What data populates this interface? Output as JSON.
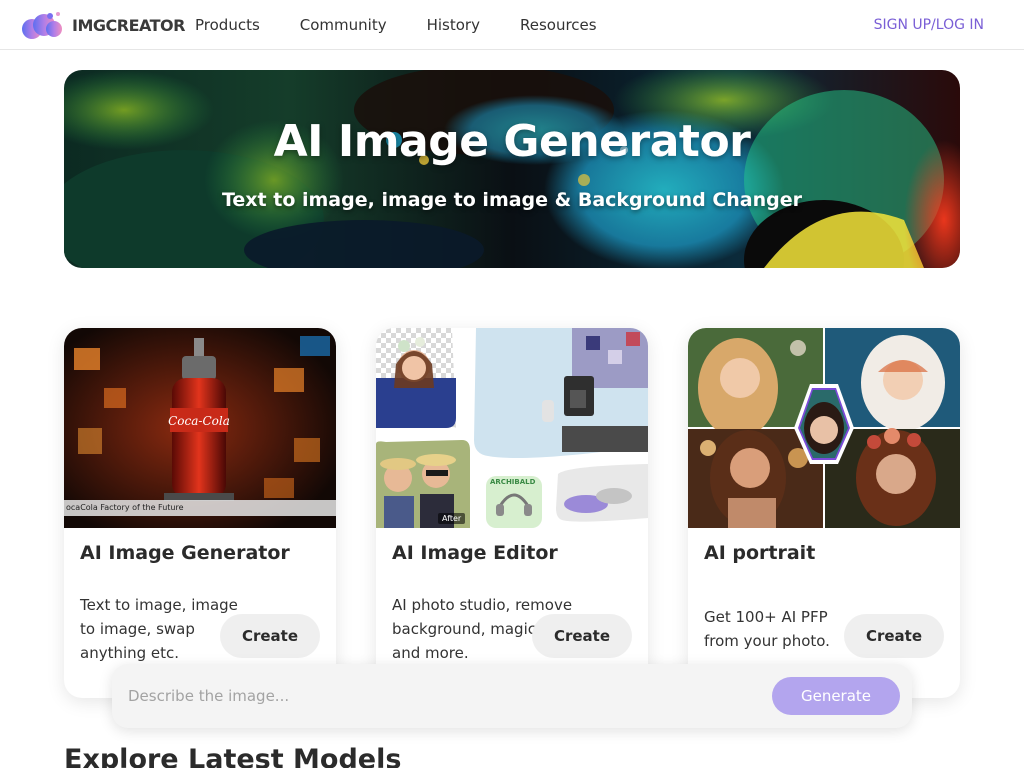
{
  "header": {
    "logo_text": "IMGCREATOR",
    "nav": [
      "Products",
      "Community",
      "History",
      "Resources"
    ],
    "signup_label": "SIGN UP/LOG IN"
  },
  "hero": {
    "title": "AI Image Generator",
    "subtitle": "Text to image, image to image & Background Changer"
  },
  "cards": [
    {
      "title": "AI Image Generator",
      "description": "Text to image, image to image, swap anything etc.",
      "button": "Create",
      "image_caption": "ocaCola Factory of the Future"
    },
    {
      "title": "AI Image Editor",
      "description": "AI photo studio, remove background, magic eraser and more.",
      "button": "Create",
      "image_tags": [
        "After",
        "ARCHIBALD"
      ]
    },
    {
      "title": "AI portrait",
      "description": "Get 100+ AI PFP from your photo.",
      "button": "Create"
    }
  ],
  "prompt": {
    "placeholder": "Describe the image...",
    "generate_label": "Generate"
  },
  "section_title": "Explore Latest Models",
  "colors": {
    "accent": "#7a5fd6",
    "generate_button": "#b3a5ee",
    "create_button": "#efefef"
  },
  "icons": {
    "logo": "cloud-blob-logo-icon"
  }
}
